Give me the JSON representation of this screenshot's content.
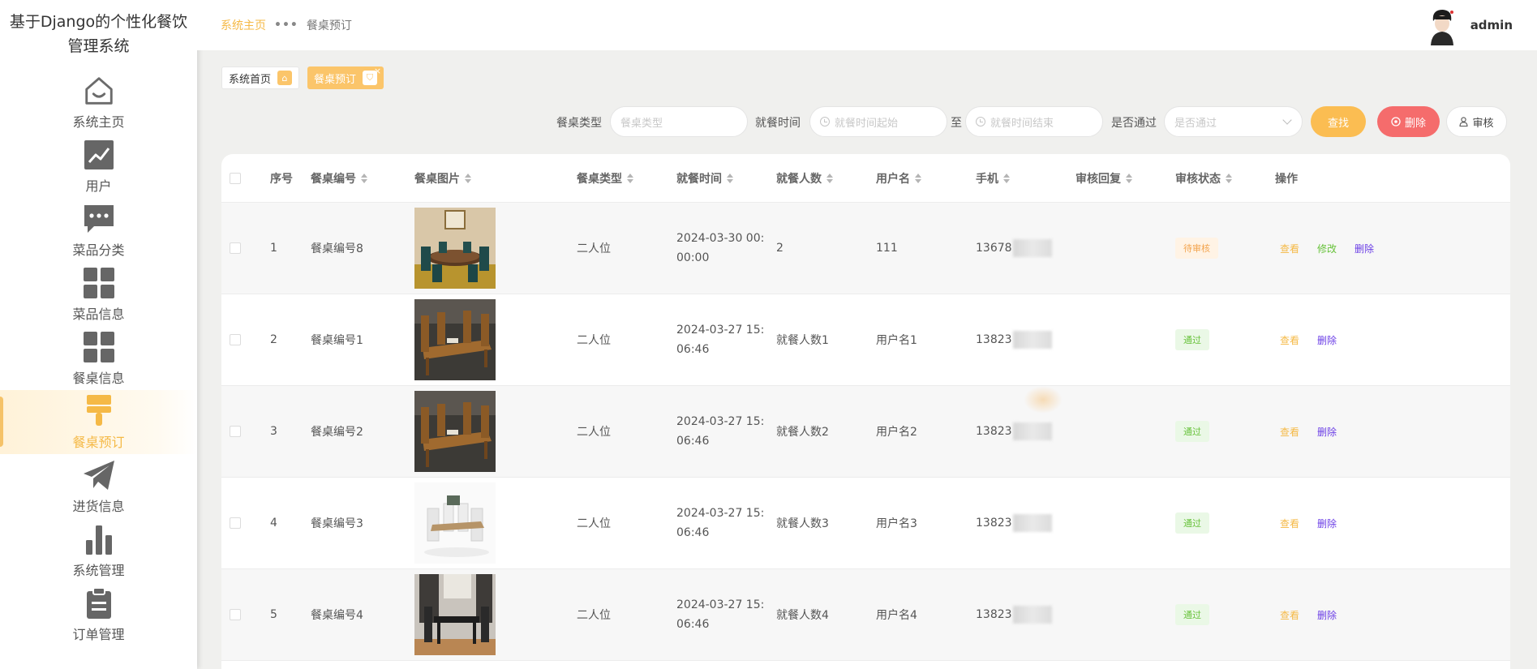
{
  "brand": {
    "line1": "基于Django的个性化餐饮",
    "line2": "管理系统"
  },
  "sidebar": {
    "items": [
      {
        "label": "系统主页",
        "icon": "home-icon"
      },
      {
        "label": "用户",
        "icon": "chart-icon"
      },
      {
        "label": "菜品分类",
        "icon": "chat-icon"
      },
      {
        "label": "菜品信息",
        "icon": "grid-icon"
      },
      {
        "label": "餐桌信息",
        "icon": "grid-icon"
      },
      {
        "label": "餐桌预订",
        "icon": "brush-icon",
        "active": true
      },
      {
        "label": "进货信息",
        "icon": "send-icon"
      },
      {
        "label": "系统管理",
        "icon": "bar-chart-icon"
      },
      {
        "label": "订单管理",
        "icon": "clipboard-icon"
      }
    ]
  },
  "header": {
    "breadcrumb_home": "系统主页",
    "breadcrumb_sep": "•••",
    "breadcrumb_current": "餐桌预订",
    "username": "admin"
  },
  "tags": {
    "home": "系统首页",
    "current": "餐桌预订",
    "close": "×"
  },
  "filters": {
    "table_type_label": "餐桌类型",
    "table_type_placeholder": "餐桌类型",
    "time_label": "就餐时间",
    "time_start_placeholder": "就餐时间起始",
    "to_label": "至",
    "time_end_placeholder": "就餐时间结束",
    "pass_label": "是否通过",
    "pass_placeholder": "是否通过",
    "search_btn": "查找",
    "delete_btn": "删除",
    "audit_btn": "审核"
  },
  "table": {
    "headers": {
      "index": "序号",
      "table_no": "餐桌编号",
      "table_pic": "餐桌图片",
      "table_type": "餐桌类型",
      "dine_time": "就餐时间",
      "people": "就餐人数",
      "username": "用户名",
      "phone": "手机",
      "reply": "审核回复",
      "status": "审核状态",
      "ops": "操作"
    },
    "rows": [
      {
        "index": "1",
        "table_no": "餐桌编号8",
        "type": "二人位",
        "time1": "2024-03-30 00:",
        "time2": "00:00",
        "people": "2",
        "username": "111",
        "phone": "13678",
        "status": "待审核",
        "status_kind": "wait",
        "view": "查看",
        "edit": "修改",
        "del": "删除",
        "pic": "round"
      },
      {
        "index": "2",
        "table_no": "餐桌编号1",
        "type": "二人位",
        "time1": "2024-03-27 15:",
        "time2": "06:46",
        "people": "就餐人数1",
        "username": "用户名1",
        "phone": "13823",
        "status": "通过",
        "status_kind": "pass",
        "view": "查看",
        "del": "删除",
        "pic": "wood"
      },
      {
        "index": "3",
        "table_no": "餐桌编号2",
        "type": "二人位",
        "time1": "2024-03-27 15:",
        "time2": "06:46",
        "people": "就餐人数2",
        "username": "用户名2",
        "phone": "13823",
        "status": "通过",
        "status_kind": "pass",
        "view": "查看",
        "del": "删除",
        "pic": "wood"
      },
      {
        "index": "4",
        "table_no": "餐桌编号3",
        "type": "二人位",
        "time1": "2024-03-27 15:",
        "time2": "06:46",
        "people": "就餐人数3",
        "username": "用户名3",
        "phone": "13823",
        "status": "通过",
        "status_kind": "pass",
        "view": "查看",
        "del": "删除",
        "pic": "white"
      },
      {
        "index": "5",
        "table_no": "餐桌编号4",
        "type": "二人位",
        "time1": "2024-03-27 15:",
        "time2": "06:46",
        "people": "就餐人数4",
        "username": "用户名4",
        "phone": "13823",
        "status": "通过",
        "status_kind": "pass",
        "view": "查看",
        "del": "删除",
        "pic": "dark"
      }
    ]
  },
  "colors": {
    "accent": "#f5b946",
    "danger": "#f56c6c",
    "pass": "#67c23a",
    "delete_link": "#6b3ee6"
  }
}
